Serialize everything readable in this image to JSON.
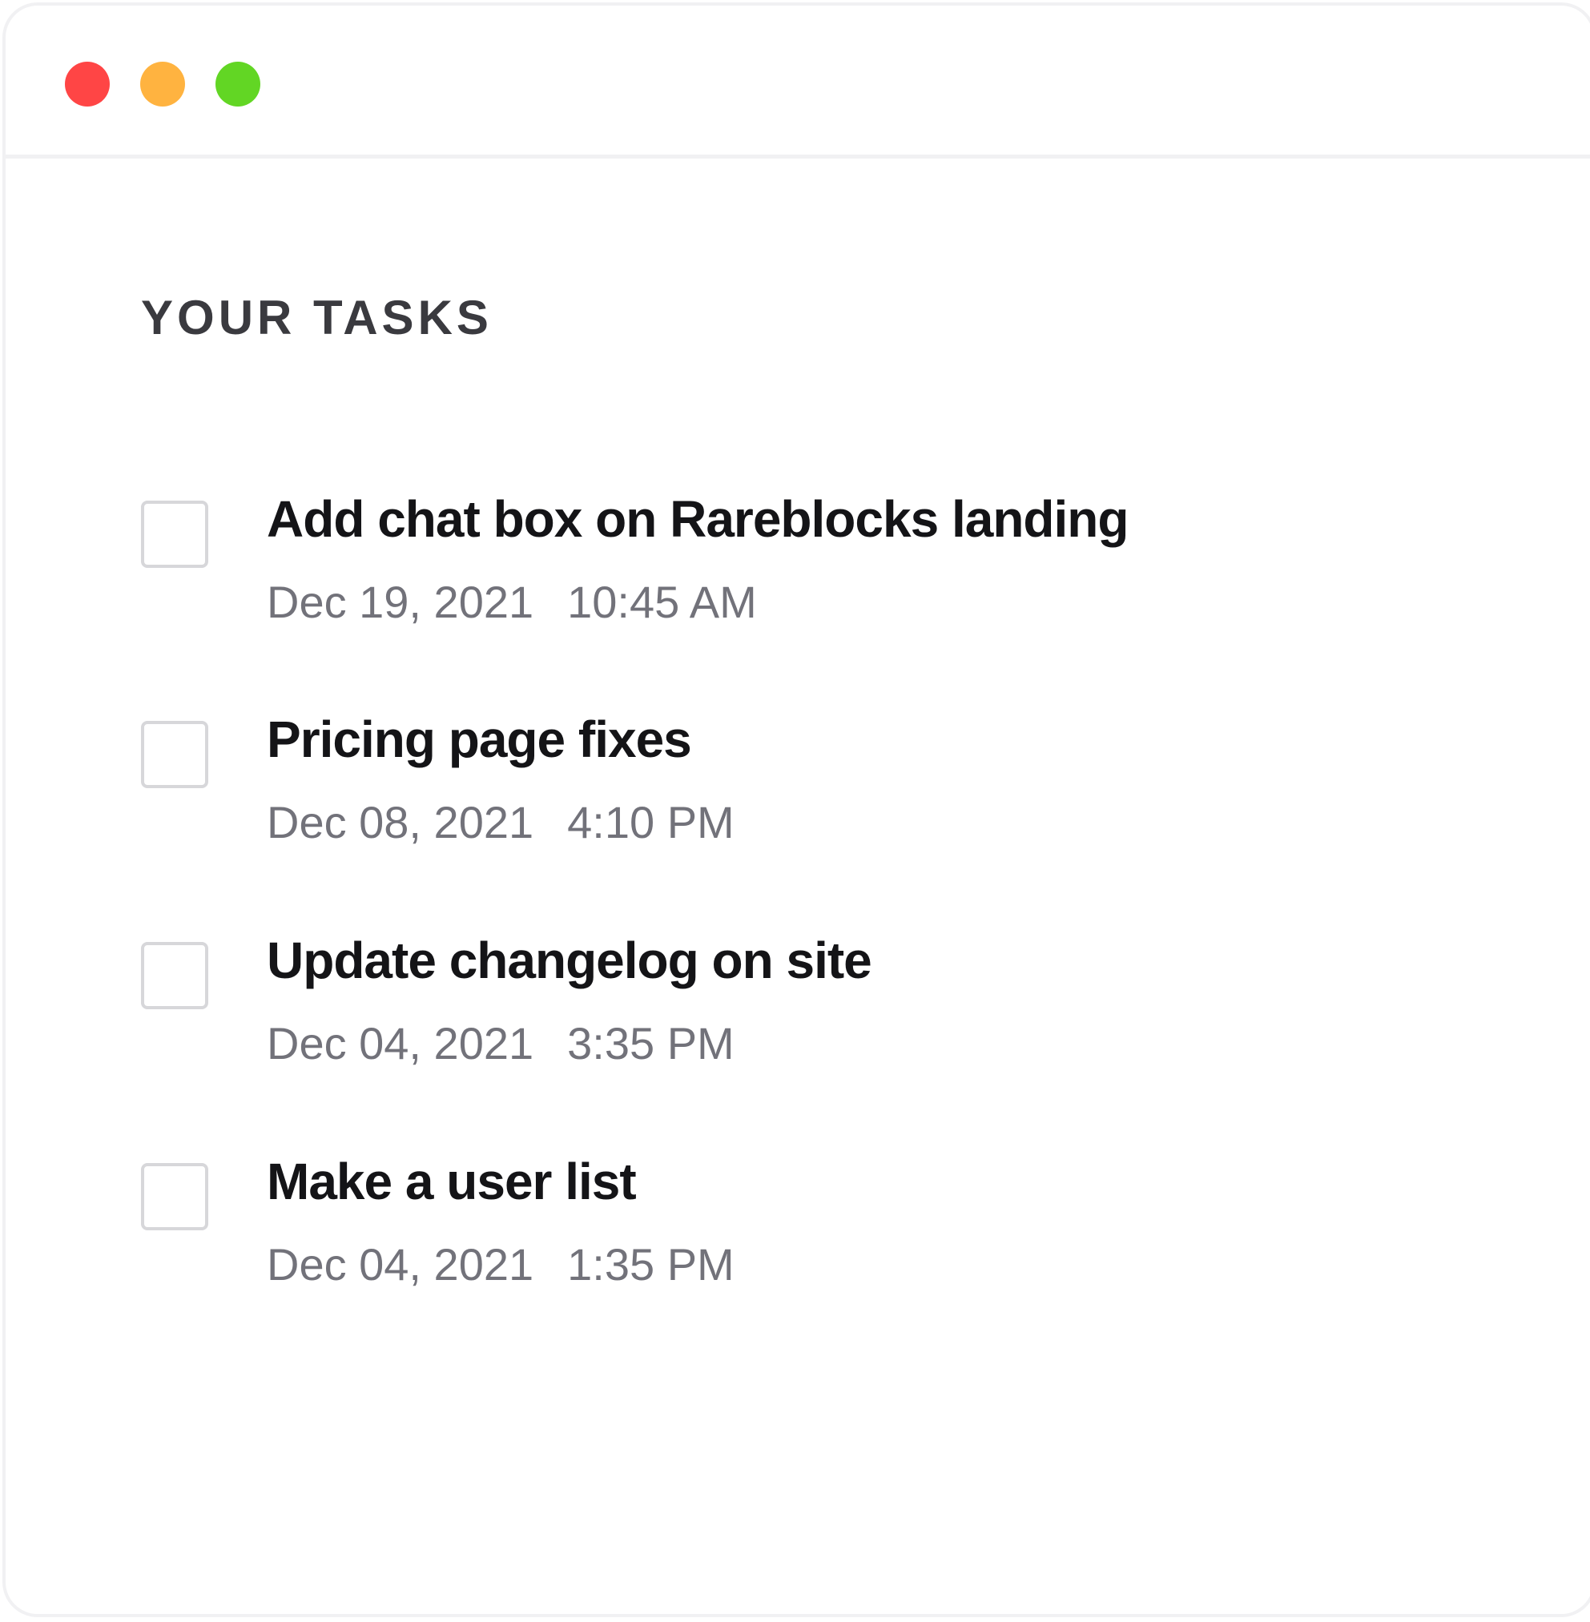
{
  "window": {
    "controls": [
      {
        "name": "close",
        "color": "#ff4545"
      },
      {
        "name": "minimize",
        "color": "#ffb340"
      },
      {
        "name": "maximize",
        "color": "#62d624"
      }
    ]
  },
  "heading": "YOUR TASKS",
  "tasks": [
    {
      "title": "Add chat box on Rareblocks landing",
      "date": "Dec 19, 2021",
      "time": "10:45 AM",
      "checked": false
    },
    {
      "title": "Pricing page fixes",
      "date": "Dec 08, 2021",
      "time": "4:10 PM",
      "checked": false
    },
    {
      "title": "Update changelog on site",
      "date": "Dec 04, 2021",
      "time": "3:35 PM",
      "checked": false
    },
    {
      "title": "Make a user list",
      "date": "Dec 04, 2021",
      "time": "1:35 PM",
      "checked": false
    }
  ]
}
